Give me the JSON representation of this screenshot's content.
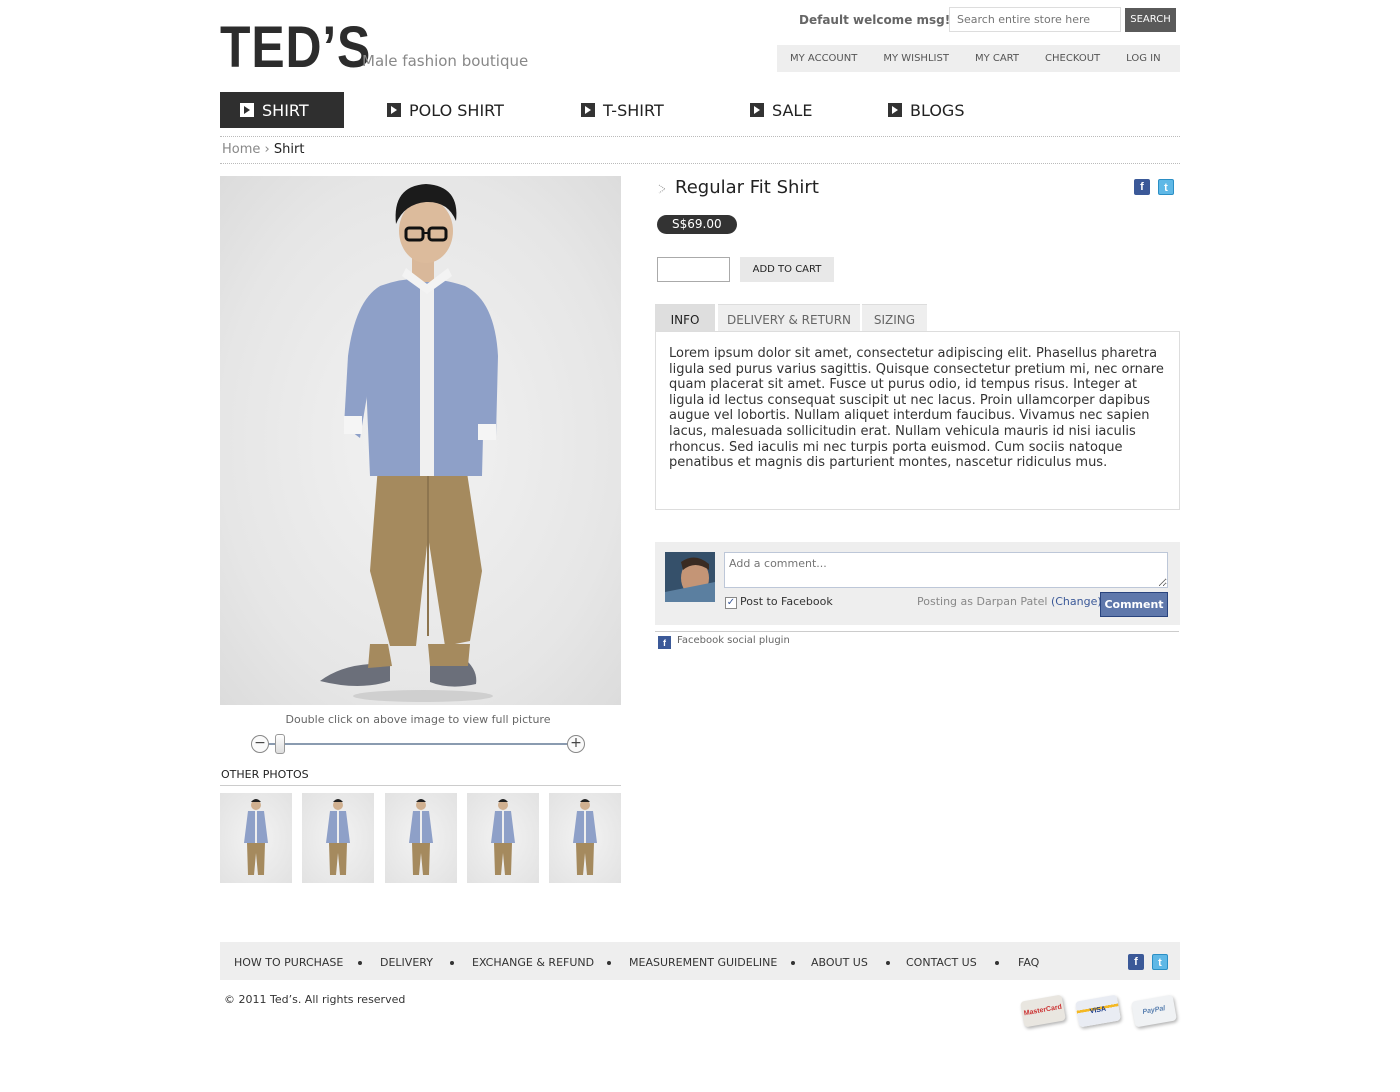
{
  "brand": {
    "logo": "TEDʼS",
    "tagline": "Male fashion boutique"
  },
  "header": {
    "welcome": "Default welcome msg!",
    "search_placeholder": "Search entire store here",
    "search_button": "SEARCH",
    "links": [
      "MY ACCOUNT",
      "MY WISHLIST",
      "MY CART",
      "CHECKOUT",
      "LOG IN"
    ]
  },
  "nav": {
    "items": [
      {
        "label": "SHIRT",
        "active": true
      },
      {
        "label": "POLO SHIRT",
        "active": false
      },
      {
        "label": "T-SHIRT",
        "active": false
      },
      {
        "label": "SALE",
        "active": false
      },
      {
        "label": "BLOGS",
        "active": false
      }
    ]
  },
  "breadcrumb": {
    "home": "Home",
    "separator": "›",
    "current": "Shirt"
  },
  "gallery": {
    "hint": "Double click on above image to view full picture",
    "other_photos_title": "OTHER PHOTOS",
    "zoom_minus": "−",
    "zoom_plus": "+",
    "zoom_level": 0
  },
  "product": {
    "title": "Regular Fit Shirt",
    "price": "S$69.00",
    "qty_value": "",
    "add_to_cart": "ADD TO CART",
    "tabs": [
      "INFO",
      "DELIVERY & RETURN",
      "SIZING"
    ],
    "active_tab": "INFO",
    "description": "Lorem ipsum dolor sit amet, consectetur adipiscing elit. Phasellus pharetra ligula sed purus varius sagittis. Quisque consectetur pretium mi, nec ornare quam placerat sit amet. Fusce ut purus odio, id tempus risus. Integer at ligula id lectus consequat suscipit ut nec lacus. Proin ullamcorper dapibus augue vel lobortis. Nullam aliquet interdum faucibus. Vivamus nec sapien lacus, malesuada sollicitudin erat. Nullam vehicula mauris id nisi iaculis rhoncus. Sed iaculis mi nec turpis porta euismod. Cum sociis natoque penatibus et magnis dis parturient montes, nascetur ridiculus mus."
  },
  "share": {
    "facebook_icon": "f",
    "twitter_icon": "t"
  },
  "comments": {
    "placeholder": "Add a comment...",
    "post_to_facebook": "Post to Facebook",
    "post_to_facebook_checked": true,
    "posting_as": "Posting as Darpan Patel",
    "change": "(Change)",
    "button": "Comment",
    "plugin_icon": "f",
    "plugin_label": "Facebook social plugin"
  },
  "footer": {
    "links": [
      "HOW TO PURCHASE",
      "DELIVERY",
      "EXCHANGE & REFUND",
      "MEASUREMENT GUIDELINE",
      "ABOUT US",
      "CONTACT US",
      "FAQ"
    ],
    "copyright": "© 2011 Ted’s. All rights reserved",
    "cards": [
      "MasterCard",
      "VISA",
      "PayPal"
    ]
  },
  "colors": {
    "accent_dark": "#2f2f2f",
    "facebook": "#3b5998",
    "twitter": "#5fb8e6"
  }
}
